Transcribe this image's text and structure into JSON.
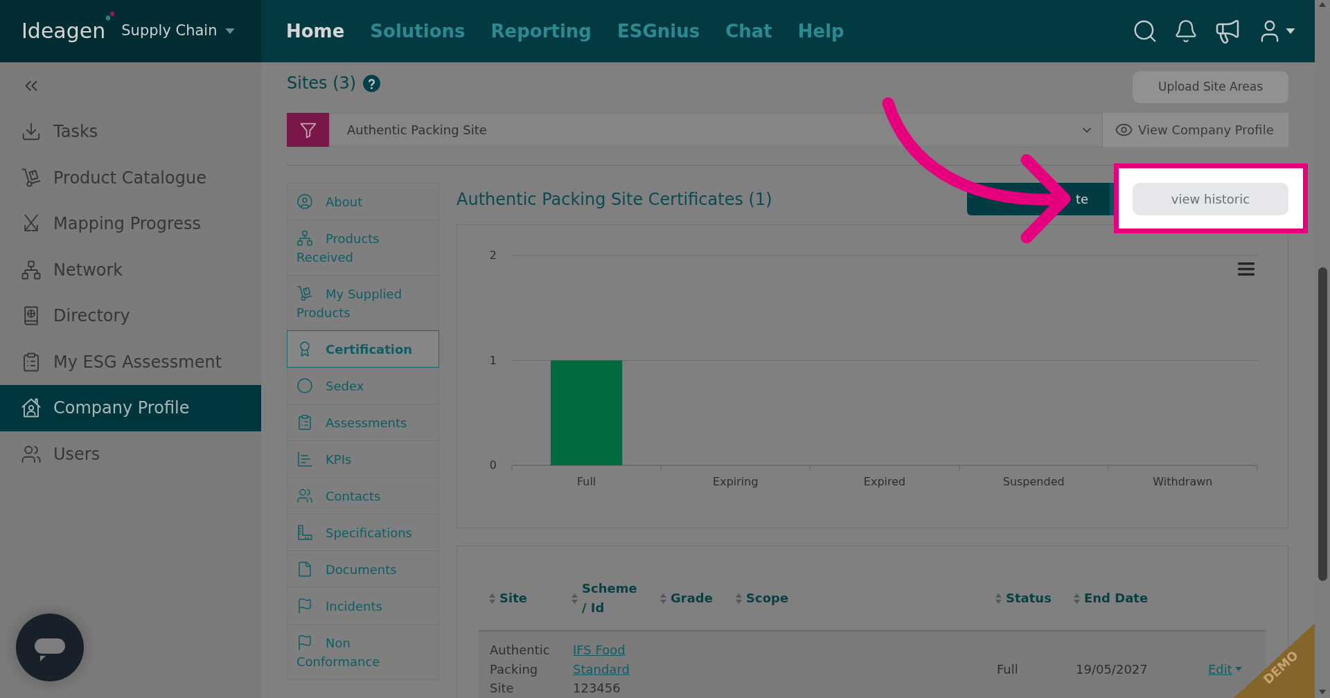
{
  "header": {
    "logo": "Ideagen",
    "product": "Supply Chain",
    "nav": [
      {
        "label": "Home",
        "selected": true
      },
      {
        "label": "Solutions",
        "selected": false
      },
      {
        "label": "Reporting",
        "selected": false
      },
      {
        "label": "ESGnius",
        "selected": false
      },
      {
        "label": "Chat",
        "selected": false
      },
      {
        "label": "Help",
        "selected": false
      }
    ]
  },
  "sidebar": {
    "items": [
      {
        "label": "Tasks",
        "selected": false
      },
      {
        "label": "Product Catalogue",
        "selected": false
      },
      {
        "label": "Mapping Progress",
        "selected": false
      },
      {
        "label": "Network",
        "selected": false
      },
      {
        "label": "Directory",
        "selected": false
      },
      {
        "label": "My ESG Assessment",
        "selected": false
      },
      {
        "label": "Company Profile",
        "selected": true
      },
      {
        "label": "Users",
        "selected": false
      }
    ]
  },
  "sites": {
    "title": "Sites (3)",
    "upload_button": "Upload Site Areas",
    "site_filter": {
      "value": "Authentic Packing Site"
    },
    "profile_button": "View Company Profile"
  },
  "site_menu": [
    {
      "label": "About",
      "selected": false
    },
    {
      "label": "Products Received",
      "selected": false
    },
    {
      "label": "My Supplied Products",
      "selected": false
    },
    {
      "label": "Certification",
      "selected": true
    },
    {
      "label": "Sedex",
      "selected": false
    },
    {
      "label": "Assessments",
      "selected": false
    },
    {
      "label": "KPIs",
      "selected": false
    },
    {
      "label": "Contacts",
      "selected": false
    },
    {
      "label": "Specifications",
      "selected": false
    },
    {
      "label": "Documents",
      "selected": false
    },
    {
      "label": "Incidents",
      "selected": false
    },
    {
      "label": "Non Conformance",
      "selected": false
    }
  ],
  "certificates": {
    "title": "Authentic Packing Site Certificates (1)",
    "primary_button": "te",
    "historic_button": "view historic",
    "chart_data": {
      "type": "bar",
      "categories": [
        "Full",
        "Expiring",
        "Expired",
        "Suspended",
        "Withdrawn"
      ],
      "values": [
        1,
        0,
        0,
        0,
        0
      ],
      "ylim": [
        0,
        2
      ],
      "yticks": [
        0,
        1,
        2
      ]
    },
    "table": {
      "columns": [
        "Site",
        "Scheme / Id",
        "Grade",
        "Scope",
        "Status",
        "End Date"
      ],
      "rows": [
        {
          "site": "Authentic Packing Site",
          "scheme": "IFS Food Standard",
          "id": "123456",
          "status": "Full",
          "end_date": "19/05/2027",
          "action": "Edit"
        }
      ]
    }
  },
  "demo_ribbon": {
    "label": "DEMO"
  }
}
